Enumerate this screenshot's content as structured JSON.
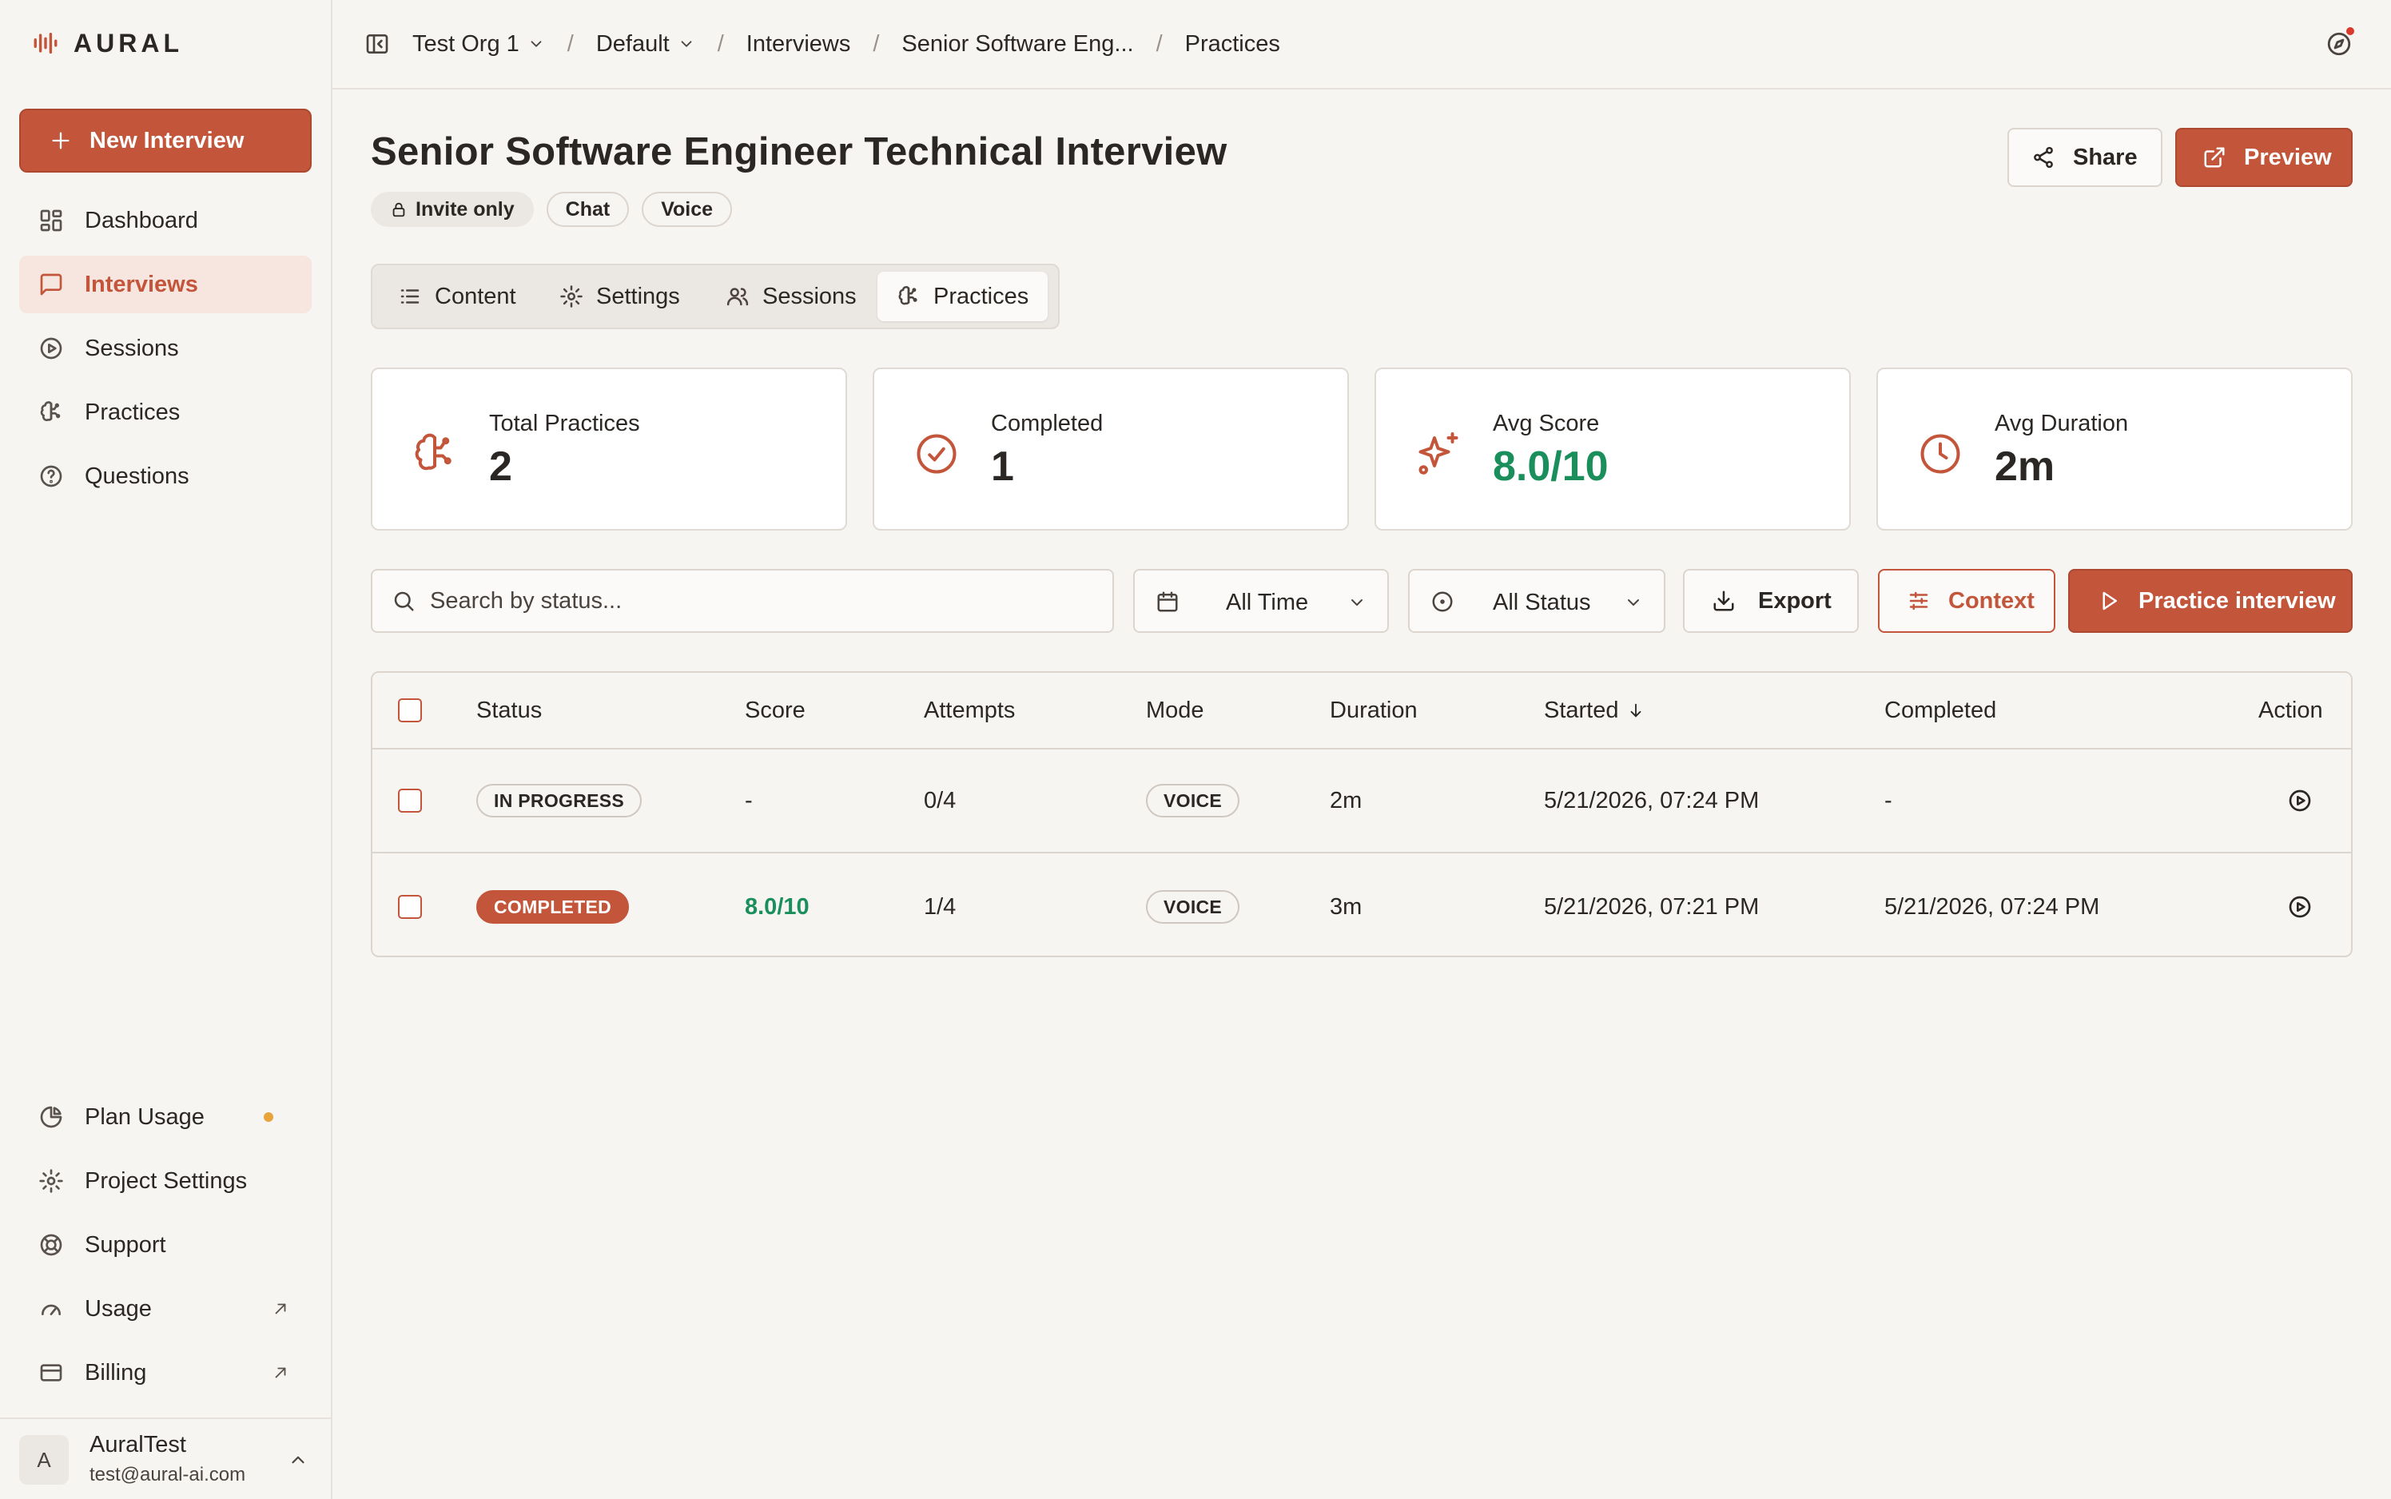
{
  "brand": {
    "name": "AURAL",
    "accent": "#c2553a"
  },
  "sidebar": {
    "new_button": "New Interview",
    "items": [
      {
        "label": "Dashboard",
        "icon": "dashboard-icon"
      },
      {
        "label": "Interviews",
        "icon": "message-square-icon",
        "active": true
      },
      {
        "label": "Sessions",
        "icon": "play-circle-icon"
      },
      {
        "label": "Practices",
        "icon": "brain-icon"
      },
      {
        "label": "Questions",
        "icon": "help-circle-icon"
      }
    ],
    "bottom_items": [
      {
        "label": "Plan Usage",
        "icon": "pie-chart-icon"
      },
      {
        "label": "Project Settings",
        "icon": "gear-icon"
      },
      {
        "label": "Support",
        "icon": "lifebuoy-icon"
      },
      {
        "label": "Usage",
        "icon": "gauge-icon"
      },
      {
        "label": "Billing",
        "icon": "credit-card-icon"
      }
    ],
    "user": {
      "initial": "A",
      "name": "AuralTest",
      "email": "test@aural-ai.com"
    }
  },
  "topbar": {
    "breadcrumbs": [
      "Test Org 1",
      "Default",
      "Interviews",
      "Senior Software Eng...",
      "Practices"
    ]
  },
  "header": {
    "title": "Senior Software Engineer Technical Interview",
    "tags": [
      "Invite only",
      "Chat",
      "Voice"
    ],
    "share_label": "Share",
    "preview_label": "Preview"
  },
  "tabs": [
    "Content",
    "Settings",
    "Sessions",
    "Practices"
  ],
  "active_tab": "Practices",
  "stats": [
    {
      "label": "Total Practices",
      "value": "2",
      "icon": "brain-icon"
    },
    {
      "label": "Completed",
      "value": "1",
      "icon": "check-circle-icon"
    },
    {
      "label": "Avg Score",
      "value": "8.0/10",
      "icon": "sparkle-icon"
    },
    {
      "label": "Avg Duration",
      "value": "2m",
      "icon": "clock-icon"
    }
  ],
  "filters": {
    "search_placeholder": "Search by status...",
    "time_select": "All Time",
    "status_select": "All Status",
    "export_label": "Export",
    "context_label": "Context",
    "practice_label": "Practice interview"
  },
  "table": {
    "columns": [
      "Status",
      "Score",
      "Attempts",
      "Mode",
      "Duration",
      "Started",
      "Completed",
      "Action"
    ],
    "rows": [
      {
        "status": "IN PROGRESS",
        "score": "-",
        "attempts": "0/4",
        "mode": "VOICE",
        "duration": "2m",
        "started": "5/21/2026, 07:24 PM",
        "completed": "-"
      },
      {
        "status": "COMPLETED",
        "score": "8.0/10",
        "attempts": "1/4",
        "mode": "VOICE",
        "duration": "3m",
        "started": "5/21/2026, 07:21 PM",
        "completed": "5/21/2026, 07:24 PM"
      }
    ]
  }
}
